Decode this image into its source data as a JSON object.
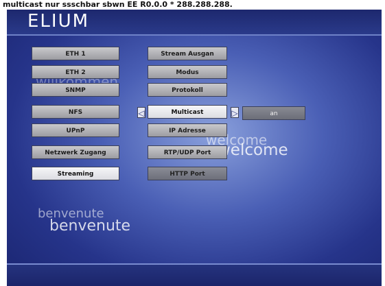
{
  "titlebar": {
    "text": "multicast nur ssschbar sbwn EE R0.0.0 * 288.288.288."
  },
  "header": {
    "logo": "ELIUM"
  },
  "watermarks": {
    "top_faint": "willkommen",
    "welcome_small": "welcome",
    "welcome_large": "welcome",
    "benvenute_small": "benvenute",
    "benvenute_large": "benvenute"
  },
  "menu_left": [
    {
      "label": "ETH 1"
    },
    {
      "label": "ETH 2"
    },
    {
      "label": "SNMP"
    },
    {
      "label": "NFS"
    },
    {
      "label": "UPnP"
    },
    {
      "label": "Netzwerk Zugang"
    },
    {
      "label": "Streaming"
    }
  ],
  "menu_mid": [
    {
      "label": "Stream Ausgan"
    },
    {
      "label": "Modus"
    },
    {
      "label": "Protokoll"
    },
    {
      "label": "Multicast"
    },
    {
      "label": "IP Adresse"
    },
    {
      "label": "RTP/UDP Port"
    },
    {
      "label": "HTTP Port"
    }
  ],
  "selector": {
    "left_arrow": "◁",
    "right_arrow": "▷",
    "value": "an"
  },
  "colors": {
    "background_center": "#8aa0dc",
    "background_edge": "#1a2570",
    "button_face": "#b4b4b8",
    "selected_face": "#ececf0"
  }
}
